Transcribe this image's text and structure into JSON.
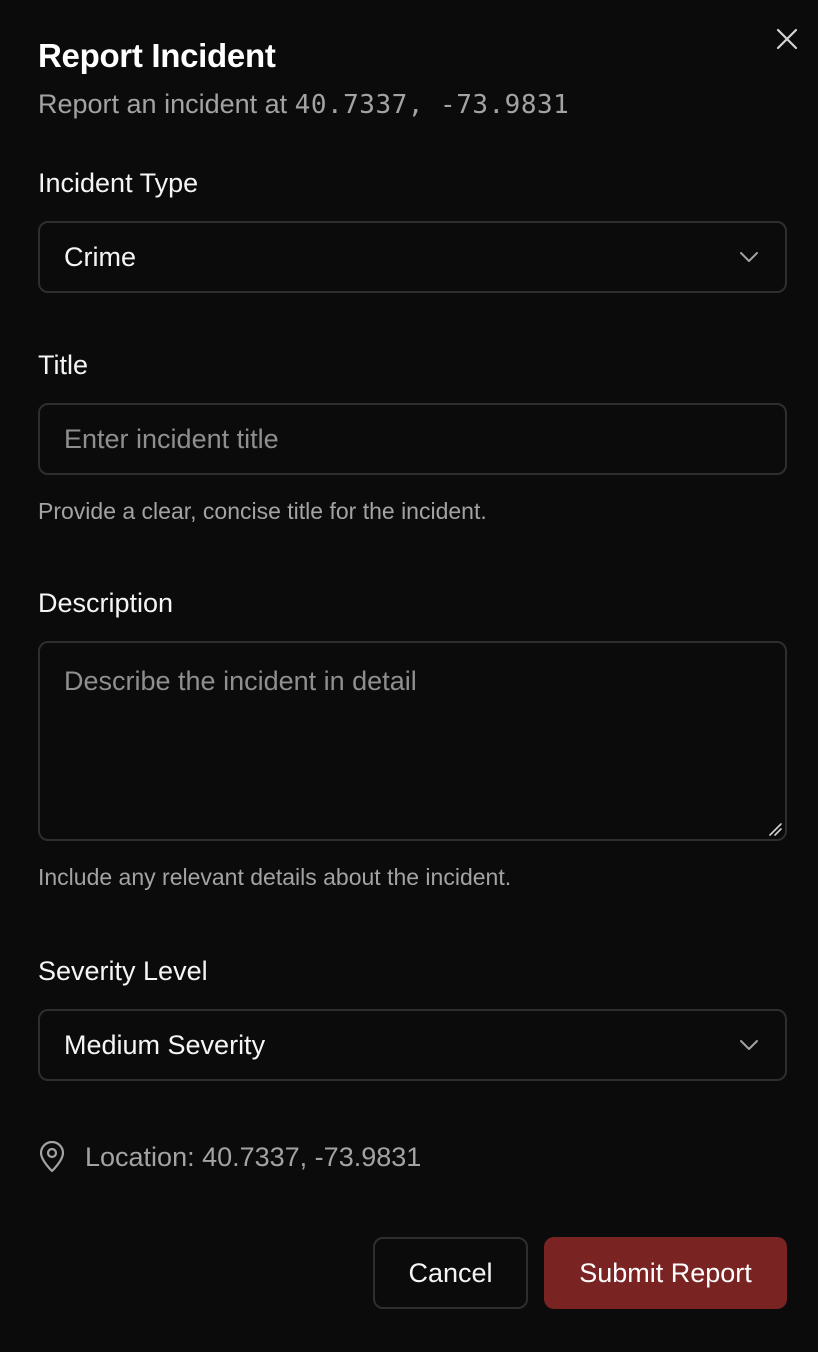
{
  "dialog": {
    "title": "Report Incident",
    "subtitle_prefix": "Report an incident at ",
    "subtitle_coords": "40.7337, -73.9831"
  },
  "form": {
    "incident_type": {
      "label": "Incident Type",
      "value": "Crime"
    },
    "title": {
      "label": "Title",
      "placeholder": "Enter incident title",
      "value": "",
      "hint": "Provide a clear, concise title for the incident."
    },
    "description": {
      "label": "Description",
      "placeholder": "Describe the incident in detail",
      "value": "",
      "hint": "Include any relevant details about the incident."
    },
    "severity": {
      "label": "Severity Level",
      "value": "Medium Severity"
    }
  },
  "location": {
    "icon": "map-pin-icon",
    "text": "Location: 40.7337, -73.9831"
  },
  "actions": {
    "cancel_label": "Cancel",
    "submit_label": "Submit Report"
  },
  "colors": {
    "background": "#0b0b0b",
    "border": "#2e2e2e",
    "muted_text": "#a3a3a3",
    "submit_bg": "#7a2323"
  }
}
